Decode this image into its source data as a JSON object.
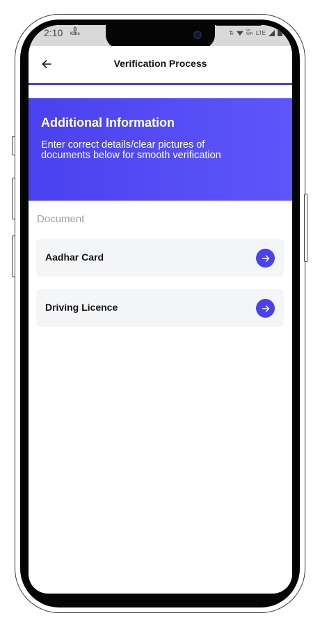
{
  "status_bar": {
    "time": "2:10",
    "speed_value": "0",
    "speed_unit": "KB/s",
    "network_label": "Vo WiFi",
    "network_type": "LTE"
  },
  "header": {
    "title": "Verification Process"
  },
  "banner": {
    "title": "Additional Information",
    "text": "Enter correct details/clear pictures of documents below for smooth verification"
  },
  "documents": {
    "section_label": "Document",
    "items": [
      {
        "label": "Aadhar Card"
      },
      {
        "label": "Driving Licence"
      }
    ]
  },
  "colors": {
    "accent": "#4a41ef",
    "row_background": "#f4f5f7",
    "muted_text": "#9aa1ad"
  },
  "icons": {
    "back": "arrow-left-icon",
    "row_action": "arrow-right-icon"
  }
}
